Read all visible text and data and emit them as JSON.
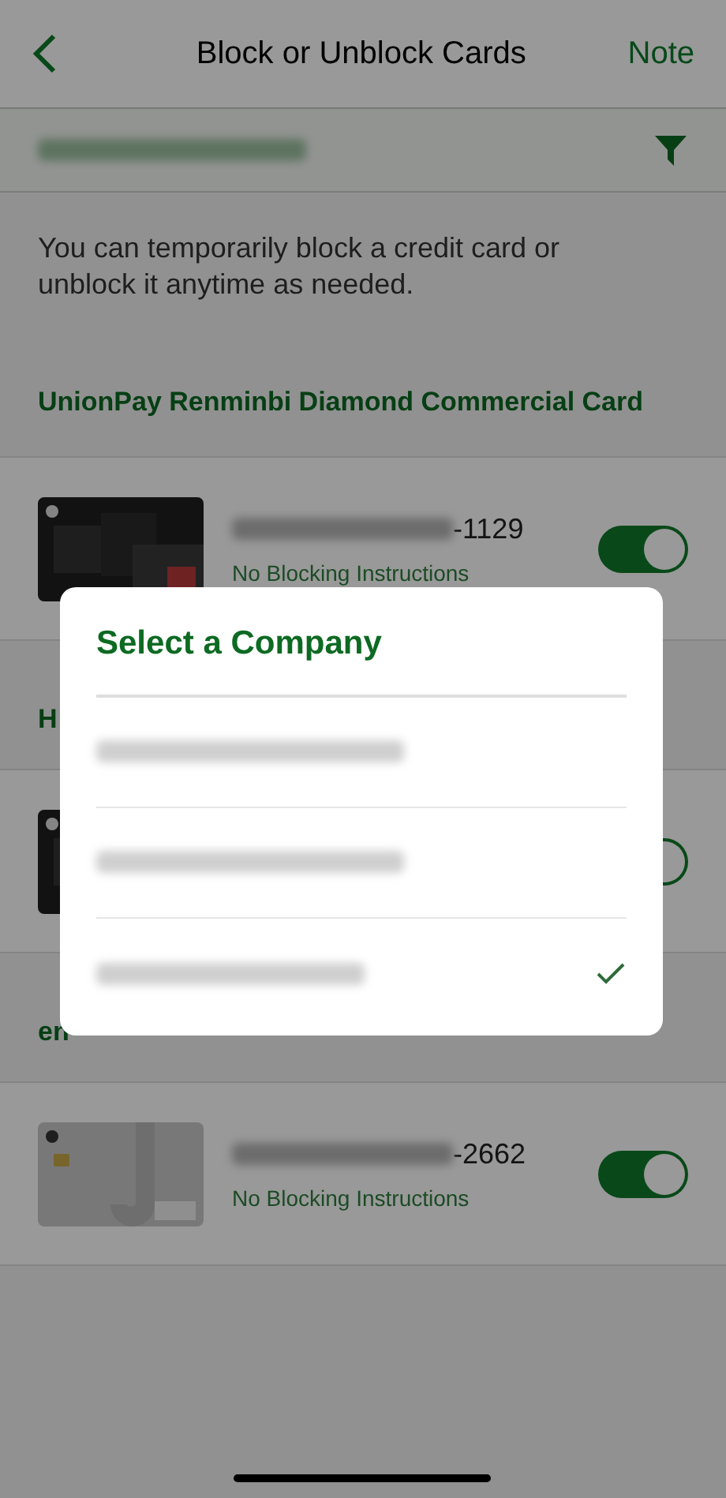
{
  "nav": {
    "title": "Block or Unblock Cards",
    "action": "Note"
  },
  "intro": "You can temporarily block a credit card or unblock it anytime as needed.",
  "sections": [
    {
      "title": "UnionPay Renminbi Diamond Commercial Card",
      "cards": [
        {
          "number_suffix": "-1129",
          "status": "No Blocking Instructions",
          "on": true,
          "kind": "dark"
        }
      ]
    },
    {
      "title": "H",
      "cards": [
        {
          "on": true,
          "kind": "dark"
        }
      ]
    },
    {
      "title": "en",
      "cards": [
        {
          "number_suffix": "-2662",
          "status": "No Blocking Instructions",
          "on": true,
          "kind": "light"
        }
      ]
    }
  ],
  "dialog": {
    "title": "Select a Company",
    "items": [
      {
        "selected": false
      },
      {
        "selected": false
      },
      {
        "selected": true
      }
    ]
  }
}
